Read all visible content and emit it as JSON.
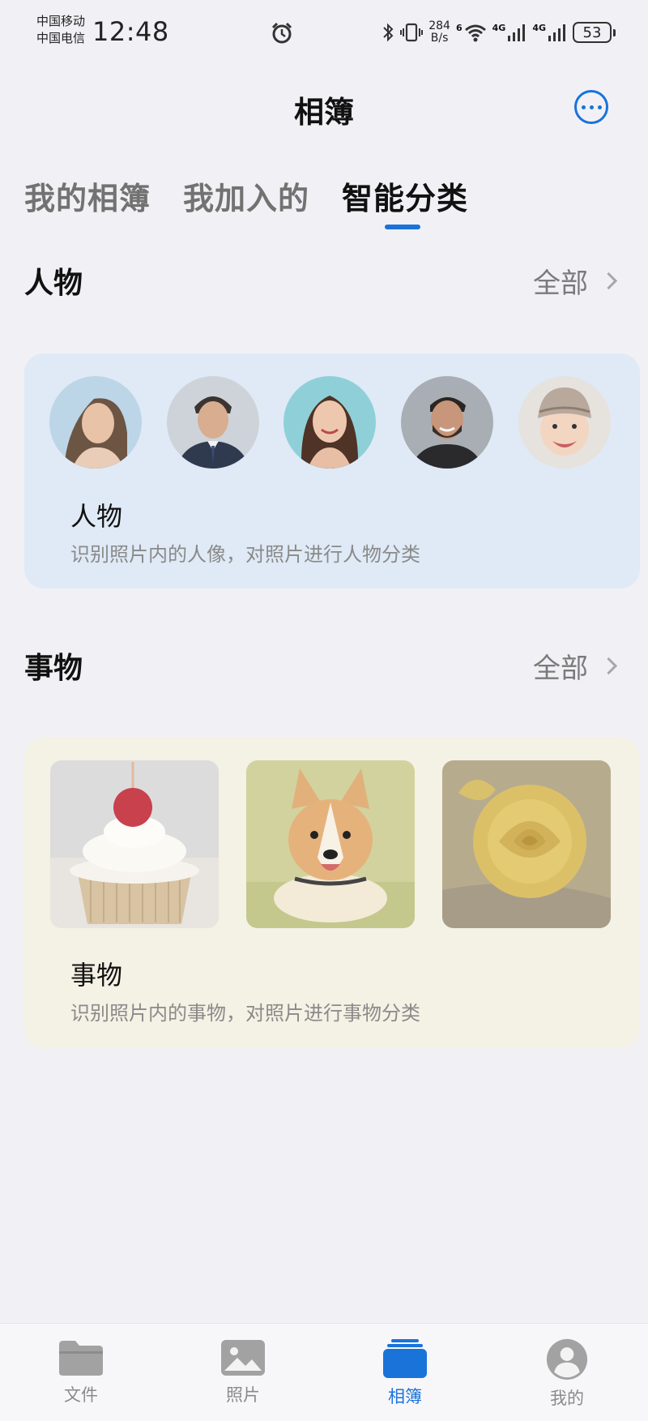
{
  "status_bar": {
    "carrier_1": "中国移动",
    "carrier_2": "中国电信",
    "time": "12:48",
    "net_speed_value": "284",
    "net_speed_unit": "B/s",
    "wifi_tag": "6",
    "signal_1_tag": "4G",
    "signal_2_tag": "4G",
    "battery": "53"
  },
  "header": {
    "title": "相簿",
    "more_icon": "more-icon"
  },
  "tabs": [
    {
      "label": "我的相簿",
      "active": false
    },
    {
      "label": "我加入的",
      "active": false
    },
    {
      "label": "智能分类",
      "active": true
    }
  ],
  "people_section": {
    "title": "人物",
    "see_all": "全部",
    "card_title": "人物",
    "card_desc": "识别照片内的人像，对照片进行人物分类"
  },
  "things_section": {
    "title": "事物",
    "see_all": "全部",
    "card_title": "事物",
    "card_desc": "识别照片内的事物，对照片进行事物分类"
  },
  "bottom_nav": [
    {
      "label": "文件",
      "icon": "folder-icon",
      "active": false
    },
    {
      "label": "照片",
      "icon": "photo-icon",
      "active": false
    },
    {
      "label": "相簿",
      "icon": "album-icon",
      "active": true
    },
    {
      "label": "我的",
      "icon": "profile-icon",
      "active": false
    }
  ],
  "colors": {
    "accent": "#1a73d9",
    "people_card_bg": "#dfeaf6",
    "things_card_bg": "#f4f1e5",
    "page_bg": "#f1f1f5"
  }
}
